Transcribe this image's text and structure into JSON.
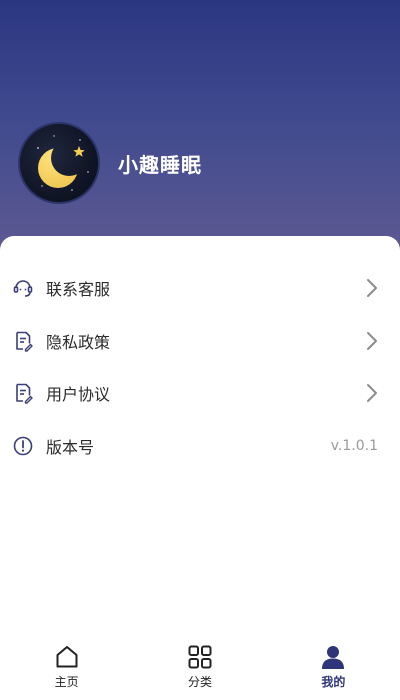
{
  "profile": {
    "app_name": "小趣睡眠",
    "avatar_icon": "moon-star-icon"
  },
  "menu": {
    "items": [
      {
        "label": "联系客服",
        "icon": "customer-service-icon"
      },
      {
        "label": "隐私政策",
        "icon": "document-edit-icon"
      },
      {
        "label": "用户协议",
        "icon": "document-edit-icon"
      },
      {
        "label": "版本号",
        "icon": "info-circle-icon",
        "value": "v.1.0.1"
      }
    ]
  },
  "tabbar": {
    "tabs": [
      {
        "label": "主页",
        "icon": "home-icon"
      },
      {
        "label": "分类",
        "icon": "grid-icon"
      },
      {
        "label": "我的",
        "icon": "user-icon",
        "active": true
      }
    ]
  },
  "colors": {
    "header_top": "#2a3680",
    "header_bottom": "#5f5a92",
    "accent": "#2e3578",
    "icon_color": "#3a3f7a"
  }
}
